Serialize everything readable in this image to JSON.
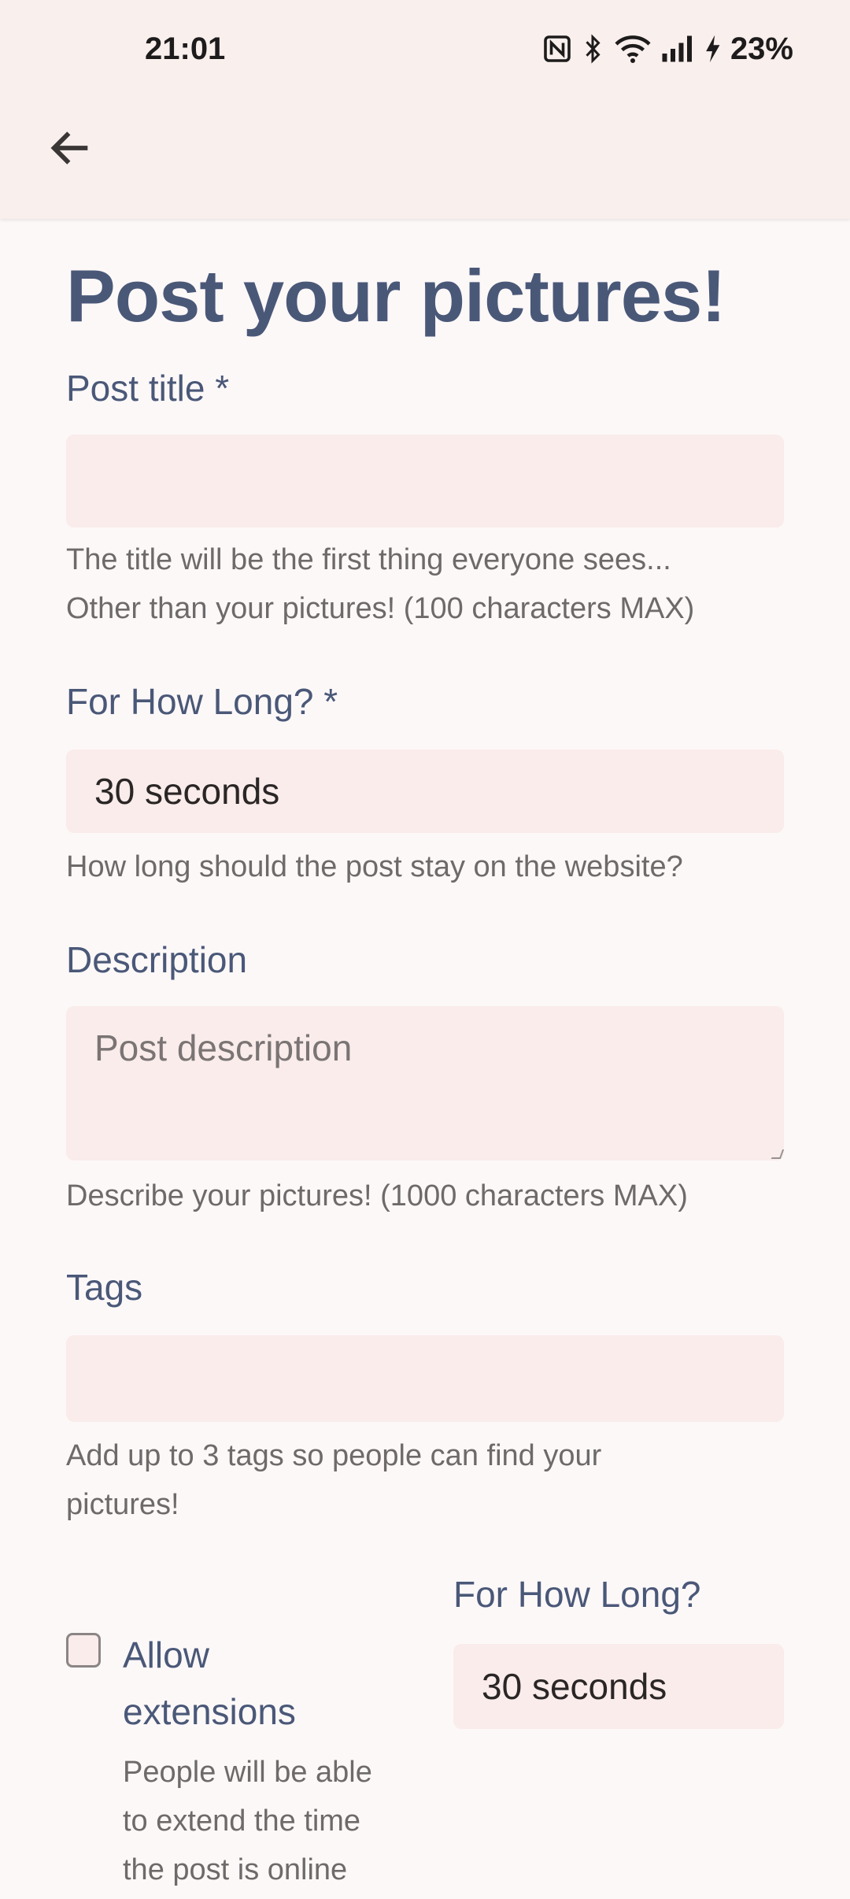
{
  "status_bar": {
    "time": "21:01",
    "battery": "23%",
    "icons": [
      "nfc-icon",
      "bluetooth-icon",
      "wifi-icon",
      "signal-icon",
      "charging-icon"
    ]
  },
  "app_bar": {
    "back_icon": "arrow-left-icon"
  },
  "page": {
    "title": "Post your pictures!"
  },
  "form": {
    "post_title": {
      "label": "Post title *",
      "value": "",
      "help_line1": "The title will be the first thing everyone sees...",
      "help_line2": "Other than your pictures! (100 characters MAX)"
    },
    "duration": {
      "label": "For How Long? *",
      "value": "30 seconds",
      "help": "How long should the post stay on the website?"
    },
    "description": {
      "label": "Description",
      "placeholder": "Post description",
      "help": "Describe your pictures! (1000 characters MAX)"
    },
    "tags": {
      "label": "Tags",
      "value": "",
      "help_line1": "Add up to 3 tags so people can find your",
      "help_line2": "pictures!"
    },
    "extensions": {
      "checkbox_label_line1": "Allow",
      "checkbox_label_line2": "extensions",
      "checked": false,
      "help_line1": "People will be able",
      "help_line2": "to extend the time",
      "help_line3": "the post is online"
    },
    "extension_duration": {
      "label": "For How Long?",
      "value": "30 seconds"
    }
  },
  "colors": {
    "background": "#fdf8f8",
    "bar": "#f9efed",
    "field": "#f9ecea",
    "accent_text": "#4a5878",
    "help_text": "#6f6a6a"
  }
}
